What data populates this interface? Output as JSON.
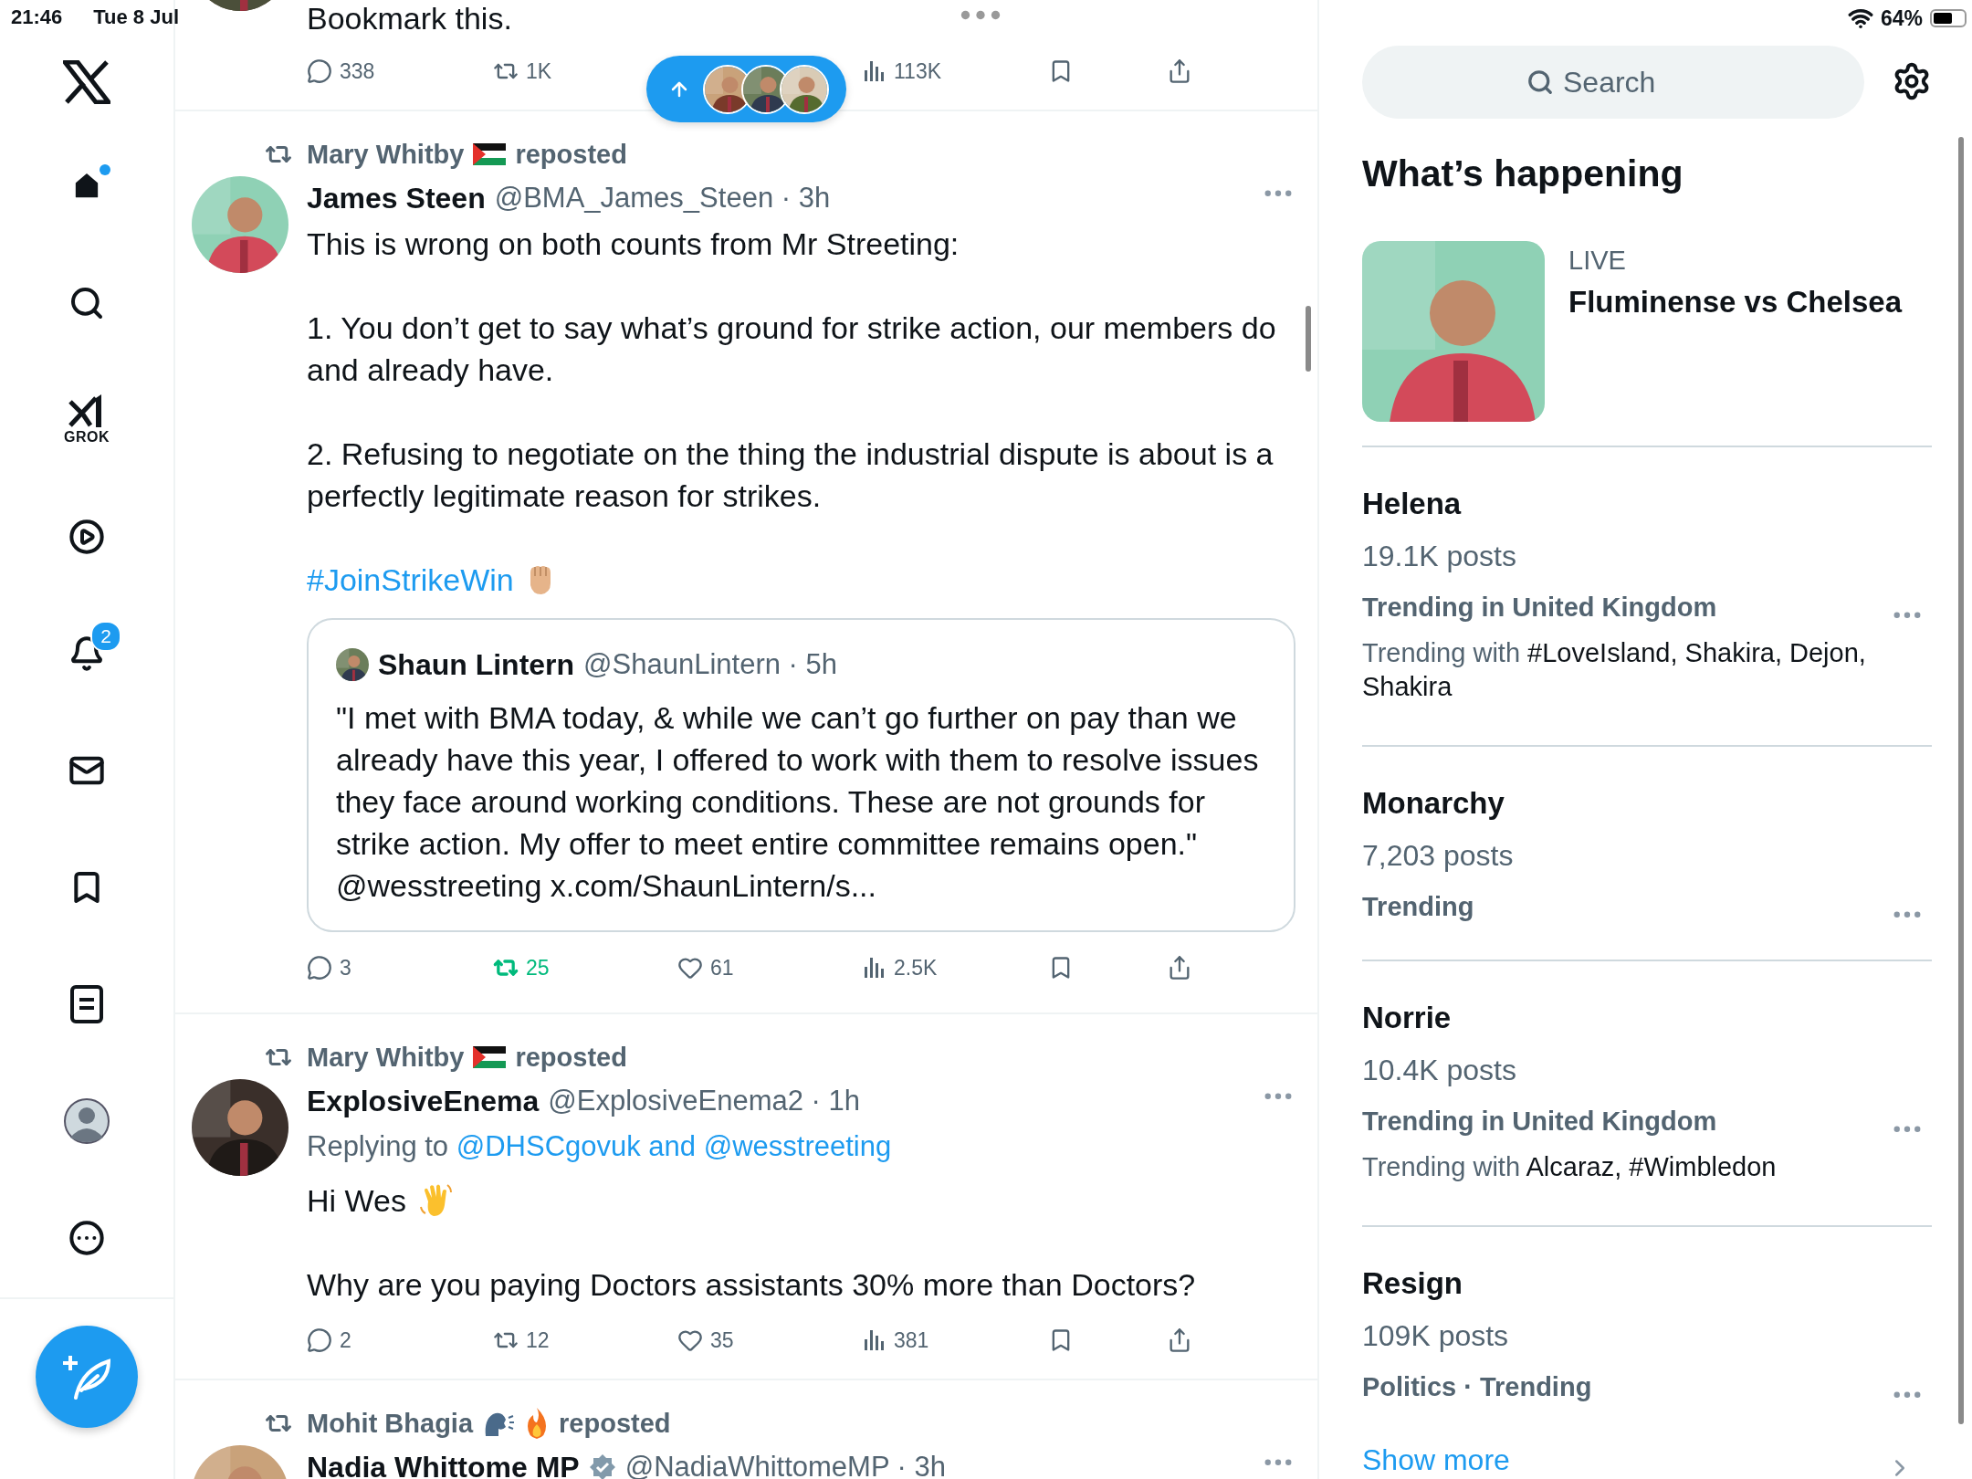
{
  "status_bar": {
    "time": "21:46",
    "date": "Tue 8 Jul",
    "battery": "64%"
  },
  "nav": {
    "items": [
      {
        "kind": "logo"
      },
      {
        "kind": "home",
        "selected": true,
        "unread_dot": true
      },
      {
        "kind": "search",
        "selected": false
      },
      {
        "kind": "grok",
        "label": "GROK",
        "selected": false
      },
      {
        "kind": "video",
        "selected": false
      },
      {
        "kind": "notifications",
        "badge": "2",
        "selected": false
      },
      {
        "kind": "messages",
        "selected": false
      },
      {
        "kind": "bookmarks",
        "selected": false
      },
      {
        "kind": "lists",
        "selected": false
      },
      {
        "kind": "profile",
        "selected": false
      },
      {
        "kind": "more",
        "selected": false
      }
    ]
  },
  "posts": [
    {
      "kind": "partial",
      "paragraphs": [
        {
          "text": "Bookmark this."
        }
      ],
      "actions": [
        {
          "kind": "reply",
          "count": "338",
          "active": false
        },
        {
          "kind": "repost",
          "count": "1K",
          "active": false
        },
        {
          "kind": "views",
          "count": "113K"
        },
        {
          "kind": "bookmark"
        },
        {
          "kind": "share"
        }
      ]
    },
    {
      "kind": "full",
      "reposted_by": {
        "name": "Mary Whitby",
        "icons": [
          {
            "kind": "flag"
          }
        ],
        "label": "reposted"
      },
      "author": "James Steen",
      "verified": false,
      "meta": "@BMA_James_Steen · 3h",
      "paragraphs": [
        {
          "text": "This is wrong on both counts from Mr Streeting:"
        },
        {
          "text": "1. You don’t get to say what’s ground for strike action, our members do and already have."
        },
        {
          "text": "2. Refusing to negotiate on the thing the industrial dispute is about is a perfectly legitimate reason for strikes."
        },
        {
          "text": "#JoinStrikeWin",
          "link": true,
          "emoji": {
            "kind": "fist"
          }
        }
      ],
      "quote": {
        "author": "Shaun Lintern",
        "meta": "@ShaunLintern · 5h",
        "lines": [
          "\"I met with BMA today, & while we can’t go further on pay than we already have this year, I offered to work with them to resolve issues they face around working conditions. These are not grounds for strike action. My offer to meet entire committee remains open.\"",
          "@wesstreeting x.com/ShaunLintern/s..."
        ]
      },
      "actions": [
        {
          "kind": "reply",
          "count": "3",
          "active": false
        },
        {
          "kind": "repost",
          "count": "25",
          "active": true
        },
        {
          "kind": "like",
          "count": "61",
          "active": false
        },
        {
          "kind": "views",
          "count": "2.5K"
        },
        {
          "kind": "bookmark"
        },
        {
          "kind": "share"
        }
      ]
    },
    {
      "kind": "full",
      "reposted_by": {
        "name": "Mary Whitby",
        "icons": [
          {
            "kind": "flag"
          }
        ],
        "label": "reposted"
      },
      "author": "ExplosiveEnema",
      "verified": false,
      "meta": "@ExplosiveEnema2 · 1h",
      "replying_to": {
        "label": "Replying to",
        "link": "@DHSCgovuk and @wesstreeting"
      },
      "paragraphs": [
        {
          "text": "Hi Wes",
          "emoji": {
            "kind": "wave"
          }
        },
        {
          "text": "Why are you paying Doctors assistants 30% more than Doctors?"
        }
      ],
      "actions": [
        {
          "kind": "reply",
          "count": "2",
          "active": false
        },
        {
          "kind": "repost",
          "count": "12",
          "active": false
        },
        {
          "kind": "like",
          "count": "35",
          "active": false
        },
        {
          "kind": "views",
          "count": "381"
        },
        {
          "kind": "bookmark"
        },
        {
          "kind": "share"
        }
      ]
    },
    {
      "kind": "full",
      "reposted_by": {
        "name": "Mohit Bhagia",
        "icons": [
          {
            "kind": "speaking-head"
          },
          {
            "kind": "fire"
          }
        ],
        "label": "reposted"
      },
      "author": "Nadia Whittome MP",
      "verified": true,
      "meta": "@NadiaWhittomeMP · 3h"
    }
  ],
  "sidebar": {
    "search": {
      "placeholder": "Search"
    },
    "heading": "What’s happening",
    "trends": [
      {
        "kind": "live",
        "label": "LIVE",
        "title": "Fluminense vs Chelsea"
      },
      {
        "kind": "trend",
        "title": "Helena",
        "posts": "19.1K posts",
        "context": "Trending in United Kingdom",
        "with_label": "Trending with",
        "with": "#LoveIsland, Shakira, Dejon, Shakira"
      },
      {
        "kind": "trend",
        "title": "Monarchy",
        "posts": "7,203 posts",
        "context": "Trending"
      },
      {
        "kind": "trend",
        "title": "Norrie",
        "posts": "10.4K posts",
        "context": "Trending in United Kingdom",
        "with_label": "Trending with",
        "with": "Alcaraz, #Wimbledon"
      },
      {
        "kind": "trend",
        "title": "Resign",
        "posts": "109K posts",
        "context": "Politics · Trending"
      }
    ],
    "show_more": "Show more"
  }
}
